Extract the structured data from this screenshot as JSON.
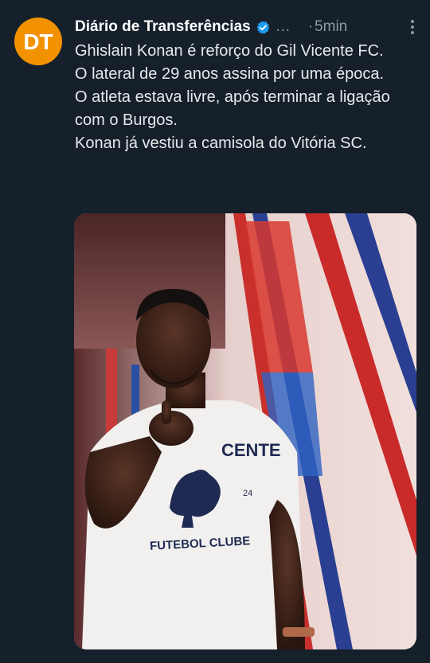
{
  "tweet": {
    "display_name": "Diário de Transferências",
    "handle": "…",
    "dot": "·",
    "time": "5min",
    "avatar_text": "DT",
    "lines": [
      "Ghislain Konan é reforço do Gil Vicente FC.",
      "O lateral de 29 anos assina por uma época.",
      "O atleta estava livre, após terminar a ligação com o Burgos.",
      "Konan já vestiu a camisola do Vitória SC."
    ]
  },
  "image": {
    "shirt_line1": "CENTE",
    "shirt_line2": "FUTEBOL CLUBE",
    "shirt_number": "24"
  },
  "colors": {
    "background": "#15202b",
    "avatar": "#f39200",
    "verified": "#1d9bf0",
    "secondary_text": "#8b98a5"
  },
  "icons": {
    "verified": "verified-badge-icon",
    "more": "more-options-icon"
  }
}
